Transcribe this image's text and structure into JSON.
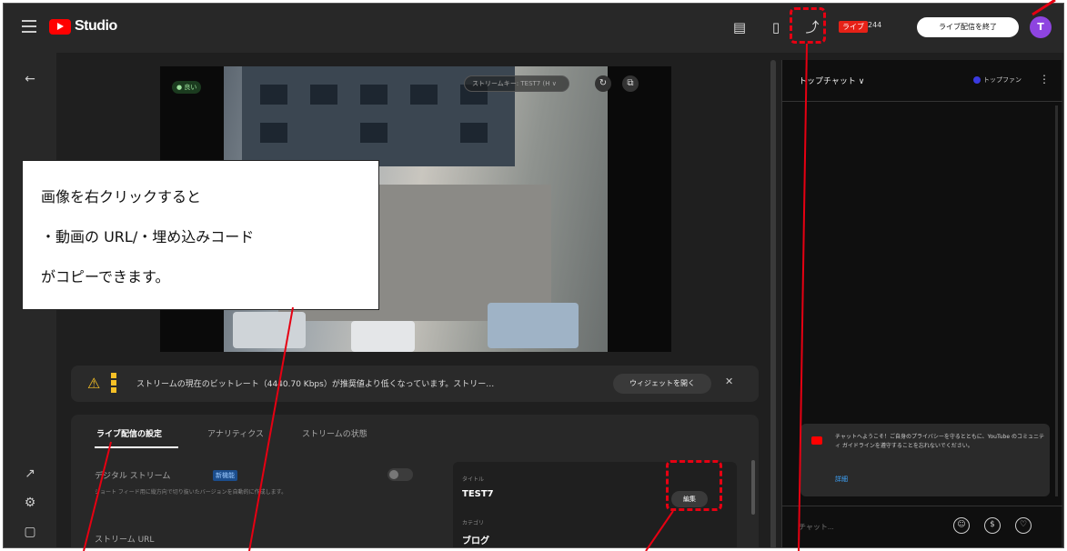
{
  "topbar": {
    "brand": "Studio",
    "live_badge": "ライブ",
    "live_count": "244",
    "end_stream_label": "ライブ配信を終了",
    "avatar_initial": "T"
  },
  "video": {
    "quality_label": "● 良い",
    "stream_selector": "ストリームキー: TEST7 (H ∨"
  },
  "warning": {
    "text": "ストリームの現在のビットレート（4440.70 Kbps）が推奨値より低くなっています。ストリー…",
    "button": "ウィジェットを開く",
    "close": "✕"
  },
  "panel": {
    "tabs": [
      "ライブ配信の設定",
      "アナリティクス",
      "ストリームの状態"
    ],
    "dvr_label": "デジタル ストリーム",
    "dvr_badge": "新機能",
    "dvr_desc": "ショート フィード用に縦方向で切り抜いたバージョンを自動的に作成します。",
    "stream_url_label": "ストリーム URL",
    "card": {
      "title_label": "タイトル",
      "title_value": "TEST7",
      "category_label": "カテゴリ",
      "category_value": "ブログ",
      "edit_button": "編集"
    }
  },
  "chat": {
    "title": "トップチャット ∨",
    "fan_chip": "トップファン",
    "welcome_text": "チャットへようこそ！ご自身のプライバシーを守るとともに、YouTube のコミュニティ ガイドラインを遵守することを忘れないでください。",
    "welcome_link": "詳細",
    "input_placeholder": "チャット..."
  },
  "annotation": {
    "line1": "画像を右クリックすると",
    "line2": "・動画の URL/・埋め込みコード",
    "line3": "がコピーできます。"
  },
  "colors": {
    "accent_red": "#e60012",
    "youtube_red": "#ff0000",
    "avatar": "#8e44e0",
    "link": "#3ea6ff"
  }
}
